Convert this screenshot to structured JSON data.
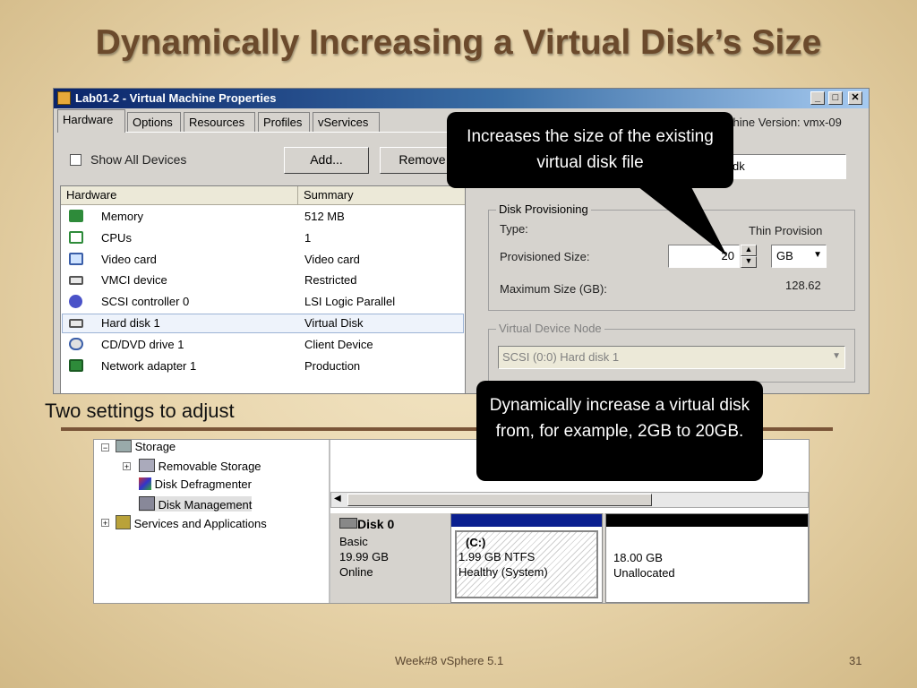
{
  "slide": {
    "title": "Dynamically Increasing a Virtual Disk’s Size",
    "subheading": "Two settings to adjust",
    "footer_text": "Week#8 vSphere 5.1",
    "page_number": "31"
  },
  "window": {
    "title": "Lab01-2 - Virtual Machine Properties",
    "tabs": [
      "Hardware",
      "Options",
      "Resources",
      "Profiles",
      "vServices"
    ],
    "machine_version": "chine Version: vmx-09",
    "show_all_devices": "Show All Devices",
    "add_button": "Add...",
    "remove_button": "Remove",
    "disk_file_fragment": "dk",
    "columns": {
      "hardware": "Hardware",
      "summary": "Summary"
    },
    "devices": [
      {
        "name": "Memory",
        "summary": "512 MB",
        "icon": "memory-icon"
      },
      {
        "name": "CPUs",
        "summary": "1",
        "icon": "cpu-icon"
      },
      {
        "name": "Video card",
        "summary": "Video card",
        "icon": "monitor-icon"
      },
      {
        "name": "VMCI device",
        "summary": "Restricted",
        "icon": "vmci-icon"
      },
      {
        "name": "SCSI controller 0",
        "summary": "LSI Logic Parallel",
        "icon": "scsi-icon"
      },
      {
        "name": "Hard disk 1",
        "summary": "Virtual Disk",
        "icon": "hard-disk-icon"
      },
      {
        "name": "CD/DVD drive 1",
        "summary": "Client Device",
        "icon": "cd-dvd-icon"
      },
      {
        "name": "Network adapter 1",
        "summary": "Production",
        "icon": "network-adapter-icon"
      }
    ],
    "selected_device": "Hard disk 1",
    "provisioning": {
      "legend": "Disk Provisioning",
      "type_label": "Type:",
      "type_value": "Thin Provision",
      "size_label": "Provisioned Size:",
      "size_value": "20",
      "unit_value": "GB",
      "max_label": "Maximum Size (GB):",
      "max_value": "128.62"
    },
    "vdn": {
      "legend": "Virtual Device Node",
      "value": "SCSI (0:0) Hard disk 1"
    }
  },
  "callouts": {
    "top": "Increases the size of the existing virtual disk file",
    "bottom": "Dynamically increase a virtual disk from, for example, 2GB to 20GB."
  },
  "disk_mgmt": {
    "tree": [
      {
        "label": "Storage",
        "icon": "storage-icon"
      },
      {
        "label": "Removable Storage",
        "icon": "removable-storage-icon"
      },
      {
        "label": "Disk Defragmenter",
        "icon": "defragmenter-icon"
      },
      {
        "label": "Disk Management",
        "icon": "disk-management-icon"
      },
      {
        "label": "Services and Applications",
        "icon": "services-icon"
      }
    ],
    "disk": {
      "name": "Disk 0",
      "type": "Basic",
      "size": "19.99 GB",
      "status": "Online"
    },
    "partitions": [
      {
        "label": "(C:)",
        "size": "1.99 GB NTFS",
        "status": "Healthy (System)",
        "color": "#0a1f8f"
      },
      {
        "label": "",
        "size": "18.00 GB",
        "status": "Unallocated",
        "color": "#000000"
      }
    ]
  }
}
